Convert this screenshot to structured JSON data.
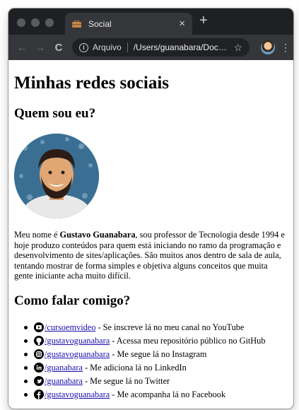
{
  "browser": {
    "tab_title": "Social",
    "tab_close": "×",
    "new_tab": "+",
    "back": "←",
    "forward": "→",
    "reload": "C",
    "info": "i",
    "scheme_label": "Arquivo",
    "url": "/Users/guanabara/Docum...",
    "star": "☆",
    "menu": "⋮"
  },
  "page": {
    "title": "Minhas redes sociais",
    "about_heading": "Quem sou eu?",
    "bio": {
      "before": "Meu nome é ",
      "name": "Gustavo Guanabara",
      "after": ", sou professor de Tecnologia desde 1994 e hoje produzo conteúdos para quem está iniciando no ramo da programação e desenvolvimento de sites/aplicações. São muitos anos dentro de sala de aula, tentando mostrar de forma simples e objetiva alguns conceitos que muita gente iniciante acha muito difícil."
    },
    "contact_heading": "Como falar comigo?",
    "links": [
      {
        "icon": "youtube-icon",
        "handle": "/cursoemvideo",
        "desc": " - Se inscreve lá no meu canal no YouTube"
      },
      {
        "icon": "github-icon",
        "handle": "/gustavoguanabara",
        "desc": " - Acessa meu repositório público no GitHub"
      },
      {
        "icon": "instagram-icon",
        "handle": "/gustavoguanabara",
        "desc": " - Me segue lá no Instagram"
      },
      {
        "icon": "linkedin-icon",
        "handle": "/guanabara",
        "desc": " - Me adiciona lá no LinkedIn"
      },
      {
        "icon": "twitter-icon",
        "handle": "/guanabara",
        "desc": " - Me segue lá no Twitter"
      },
      {
        "icon": "facebook-icon",
        "handle": "/gustavoguanabara",
        "desc": " - Me acompanha lá no Facebook"
      }
    ]
  },
  "colors": {
    "link": "#1a0dab",
    "chrome_dark": "#1f2023",
    "chrome_toolbar": "#35363a"
  }
}
